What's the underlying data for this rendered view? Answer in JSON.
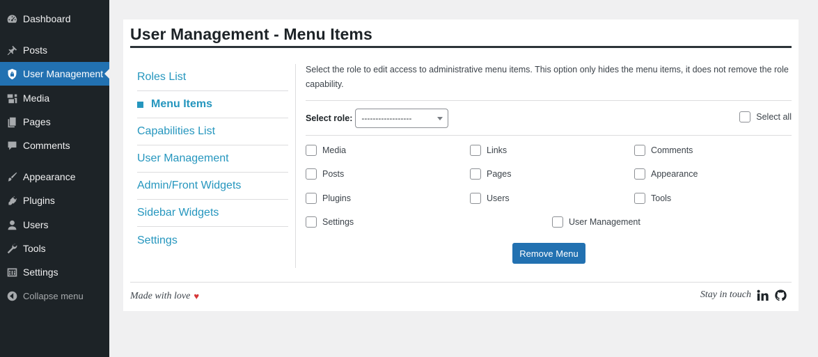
{
  "sidebar": {
    "items": [
      {
        "label": "Dashboard",
        "icon": "dashboard-icon"
      },
      {
        "label": "Posts",
        "icon": "pin-icon"
      },
      {
        "label": "User Management",
        "icon": "lock-icon",
        "current": true
      },
      {
        "label": "Media",
        "icon": "media-icon"
      },
      {
        "label": "Pages",
        "icon": "pages-icon"
      },
      {
        "label": "Comments",
        "icon": "comment-icon"
      },
      {
        "label": "Appearance",
        "icon": "brush-icon"
      },
      {
        "label": "Plugins",
        "icon": "plugin-icon"
      },
      {
        "label": "Users",
        "icon": "user-icon"
      },
      {
        "label": "Tools",
        "icon": "wrench-icon"
      },
      {
        "label": "Settings",
        "icon": "settings-icon"
      }
    ],
    "collapse_label": "Collapse menu"
  },
  "page": {
    "title": "User Management - Menu Items"
  },
  "subnav": {
    "items": [
      "Roles List",
      "Menu Items",
      "Capabilities List",
      "User Management",
      "Admin/Front Widgets",
      "Sidebar Widgets",
      "Settings"
    ],
    "active": "Menu Items"
  },
  "content": {
    "description": "Select the role to edit access to administrative menu items. This option only hides the menu items, it does not remove the role capability.",
    "role_label": "Select role:",
    "role_value": "------------------",
    "select_all_label": "Select all",
    "menu_checkboxes": [
      [
        "Media",
        "Links",
        "Comments"
      ],
      [
        "Posts",
        "Pages",
        "Appearance"
      ],
      [
        "Plugins",
        "Users",
        "Tools"
      ],
      [
        "Settings",
        "User Management"
      ]
    ],
    "button_label": "Remove Menu"
  },
  "footer": {
    "left_text": "Made with love",
    "heart": "♥",
    "right_text": "Stay in touch"
  },
  "colors": {
    "sidebar_bg": "#1d2327",
    "accent": "#2271b1",
    "link": "#2596be",
    "heart": "#d63638"
  }
}
